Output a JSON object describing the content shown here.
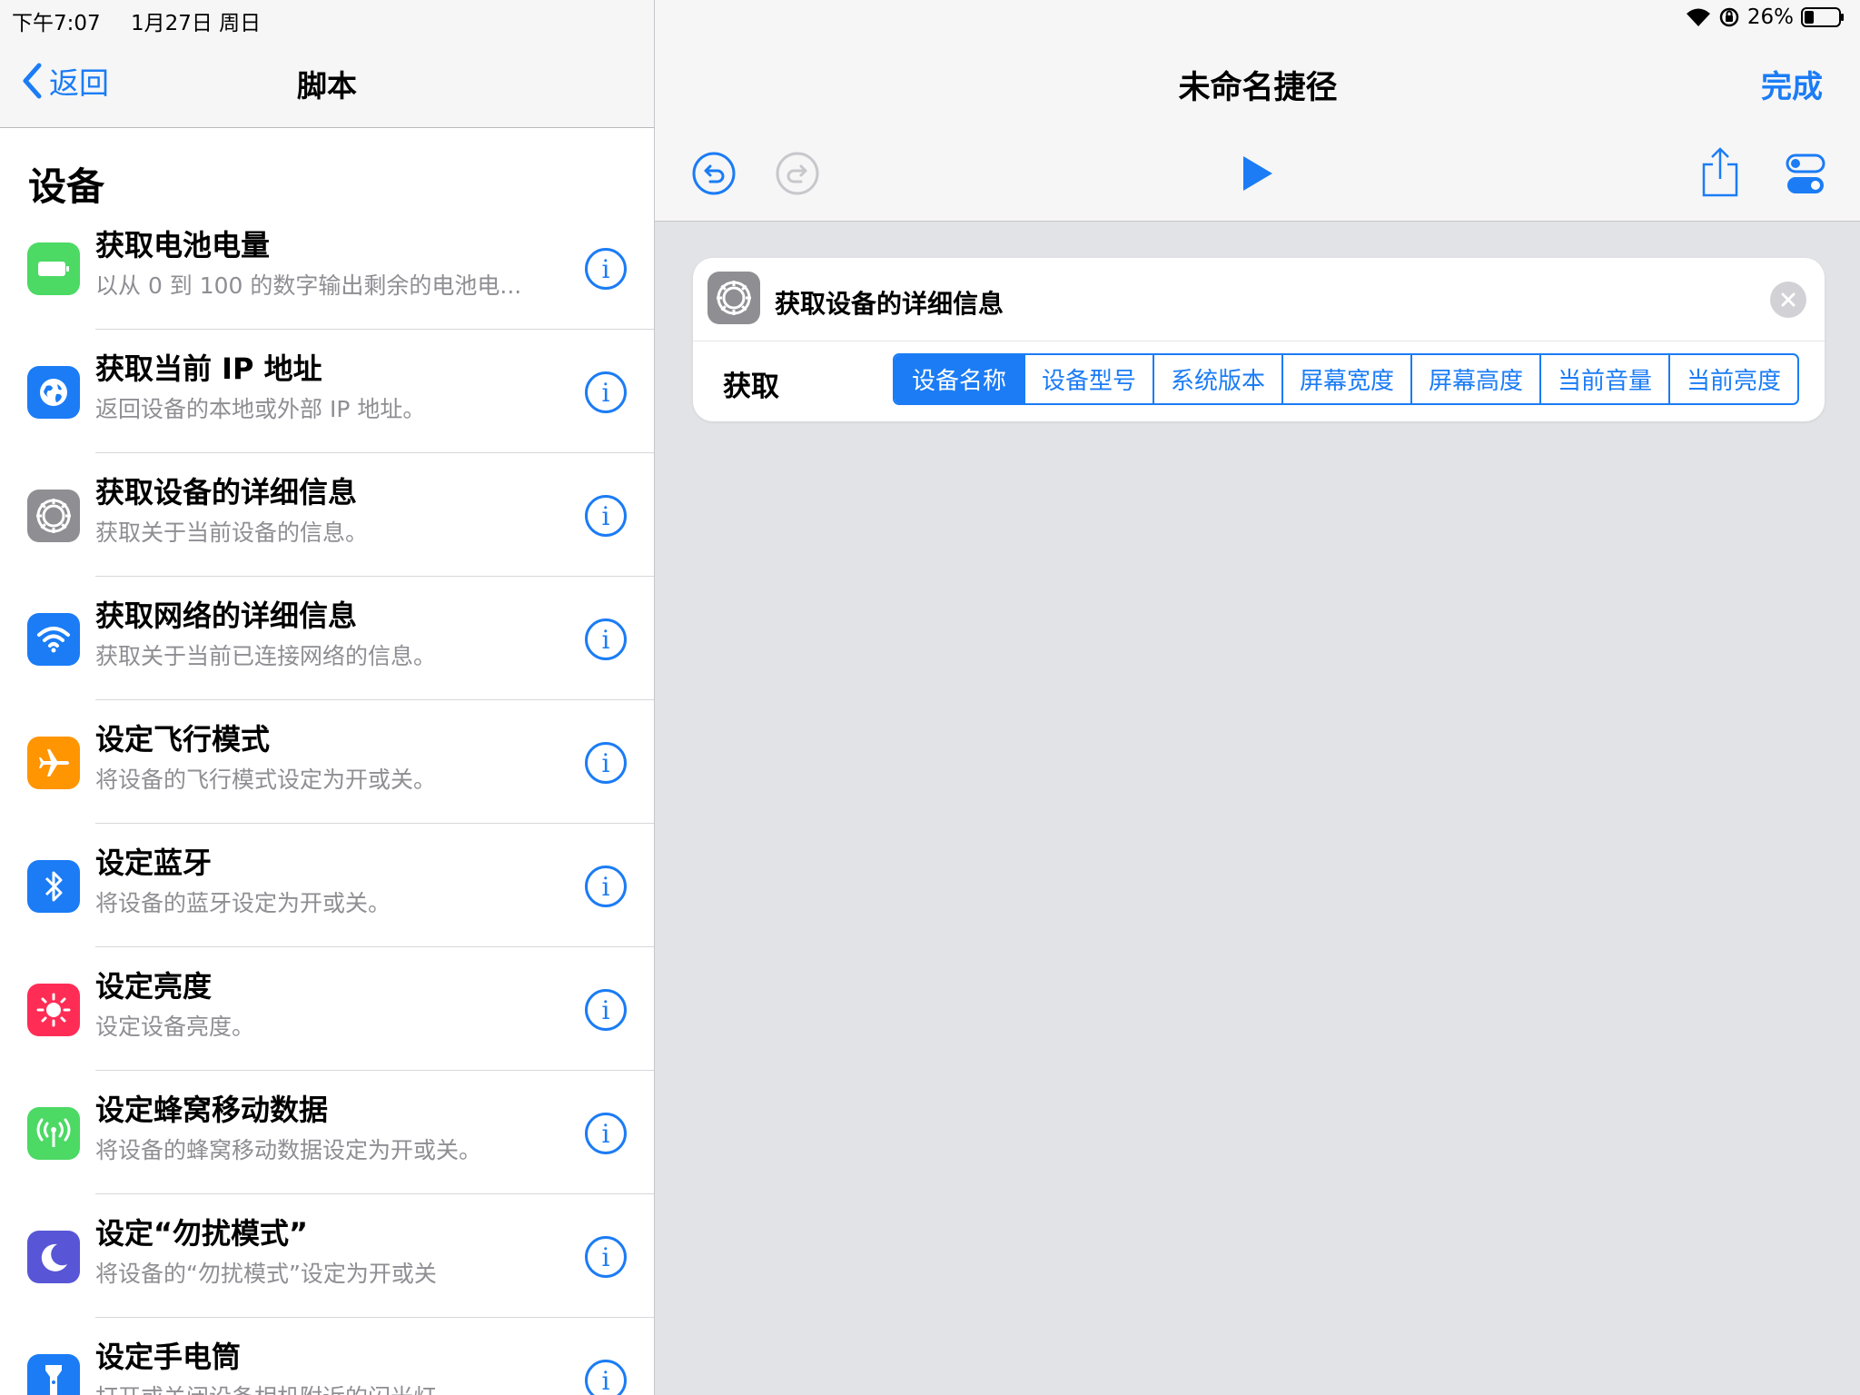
{
  "status": {
    "time": "下午7:07",
    "date": "1月27日 周日",
    "battery": "26%"
  },
  "left": {
    "back_label": "返回",
    "title": "脚本",
    "section": "设备",
    "items": [
      {
        "title": "获取电池电量",
        "subtitle": "以从 0 到 100 的数字输出剩余的电池电...",
        "icon": "battery-icon",
        "color": "#4cd964"
      },
      {
        "title": "获取当前 IP 地址",
        "subtitle": "返回设备的本地或外部 IP 地址。",
        "icon": "globe-icon",
        "color": "#1b7cf5"
      },
      {
        "title": "获取设备的详细信息",
        "subtitle": "获取关于当前设备的信息。",
        "icon": "gear-icon",
        "color": "#8e8e93"
      },
      {
        "title": "获取网络的详细信息",
        "subtitle": "获取关于当前已连接网络的信息。",
        "icon": "wifi-icon",
        "color": "#1b7cf5"
      },
      {
        "title": "设定飞行模式",
        "subtitle": "将设备的飞行模式设定为开或关。",
        "icon": "airplane-icon",
        "color": "#ff9500"
      },
      {
        "title": "设定蓝牙",
        "subtitle": "将设备的蓝牙设定为开或关。",
        "icon": "bluetooth-icon",
        "color": "#1b7cf5"
      },
      {
        "title": "设定亮度",
        "subtitle": "设定设备亮度。",
        "icon": "sun-icon",
        "color": "#ff2d55"
      },
      {
        "title": "设定蜂窝移动数据",
        "subtitle": "将设备的蜂窝移动数据设定为开或关。",
        "icon": "antenna-icon",
        "color": "#4cd964"
      },
      {
        "title": "设定“勿扰模式”",
        "subtitle": "将设备的“勿扰模式”设定为开或关",
        "icon": "moon-icon",
        "color": "#5856d6"
      },
      {
        "title": "设定手电筒",
        "subtitle": "打开或关闭设备相机附近的闪光灯。",
        "icon": "flashlight-icon",
        "color": "#1b7cf5"
      }
    ]
  },
  "right": {
    "title": "未命名捷径",
    "done_label": "完成",
    "card": {
      "title": "获取设备的详细信息",
      "label": "获取",
      "options": [
        "设备名称",
        "设备型号",
        "系统版本",
        "屏幕宽度",
        "屏幕高度",
        "当前音量",
        "当前亮度"
      ],
      "selected": "设备名称"
    }
  }
}
